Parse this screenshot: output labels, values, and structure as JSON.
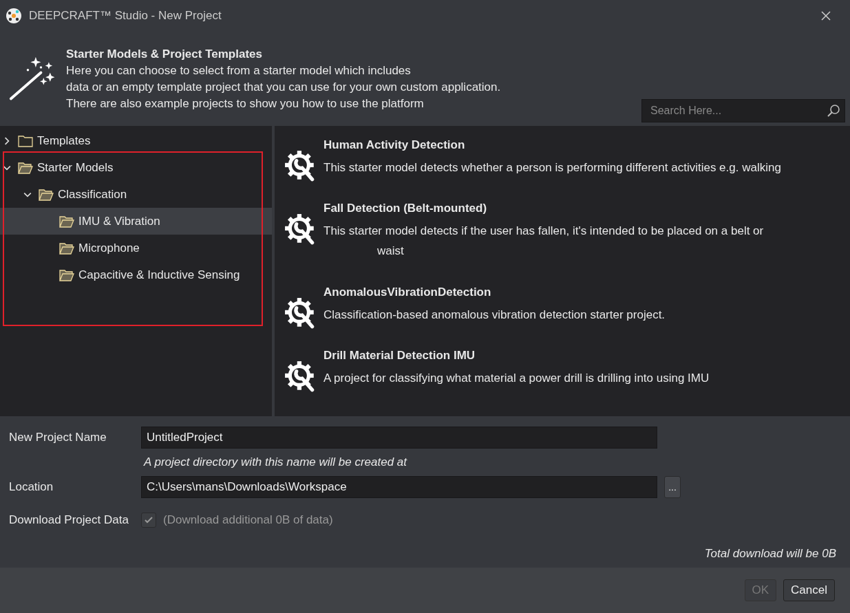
{
  "window": {
    "title": "DEEPCRAFT™ Studio - New Project"
  },
  "header": {
    "title": "Starter Models & Project Templates",
    "lines": [
      "Here you can choose to select from a starter model which includes",
      "data or an empty template project that you can use for your own custom application.",
      "There are also example projects to show you how to use the platform"
    ]
  },
  "search": {
    "placeholder": "Search Here..."
  },
  "tree": [
    {
      "label": "Templates",
      "expanded": false,
      "selected": false
    },
    {
      "label": "Starter Models",
      "expanded": true,
      "selected": false,
      "children": [
        {
          "label": "Classification",
          "expanded": true,
          "selected": false,
          "children": [
            {
              "label": "IMU & Vibration",
              "selected": true
            },
            {
              "label": "Microphone",
              "selected": false
            },
            {
              "label": "Capacitive & Inductive Sensing",
              "selected": false
            }
          ]
        }
      ]
    }
  ],
  "projects": [
    {
      "title": "Human Activity Detection",
      "description": [
        "This starter model detects whether a person is performing different activities e.g. walking"
      ]
    },
    {
      "title": "Fall Detection (Belt-mounted)",
      "description": [
        "This starter model detects if the user has fallen, it's intended to be placed on a belt or",
        "waist"
      ]
    },
    {
      "title": "AnomalousVibrationDetection",
      "description": [
        "Classification-based anomalous vibration detection starter project."
      ]
    },
    {
      "title": "Drill Material Detection IMU",
      "description": [
        "A project for classifying what material a power drill is drilling into using IMU"
      ]
    }
  ],
  "form": {
    "name_label": "New Project Name",
    "name_value": "UntitledProject",
    "hint": "A project directory with this name will be created at",
    "location_label": "Location",
    "location_value": "C:\\Users\\mans\\Downloads\\Workspace",
    "browse": "...",
    "download_label": "Download Project Data",
    "download_checked": true,
    "download_disabled": true,
    "download_note": "(Download additional 0B of data)",
    "total": "Total download will be 0B"
  },
  "buttons": [
    {
      "label": "OK",
      "disabled": true
    },
    {
      "label": "Cancel",
      "disabled": false
    }
  ]
}
